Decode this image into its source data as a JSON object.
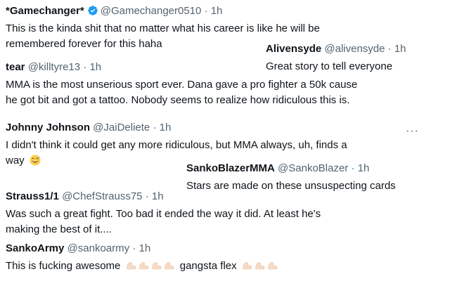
{
  "posts": [
    {
      "name": "*Gamechanger*",
      "handle": "@Gamechanger0510",
      "sep": "·",
      "time": "1h",
      "lines": [
        "This is the kinda shit that no matter what his career is like he will be",
        "remembered forever for this haha"
      ]
    },
    {
      "name": "Alivensyde",
      "handle": "@alivensyde",
      "sep": "·",
      "time": "1h",
      "lines": [
        "Great story to tell everyone"
      ]
    },
    {
      "name": "tear",
      "handle": "@killtyre13",
      "sep": "·",
      "time": "1h",
      "lines": [
        "MMA is the most unserious sport ever. Dana gave a pro fighter a 50k cause",
        "he got bit and got a tattoo. Nobody seems to realize how ridiculous this is."
      ]
    },
    {
      "name": "Johnny Johnson",
      "handle": "@JaiDeliete",
      "sep": "·",
      "time": "1h",
      "lines": [
        "I didn't think it could get any more ridiculous, but MMA always, uh, finds a",
        "way"
      ],
      "more": "···"
    },
    {
      "name": "SankoBlazerMMA",
      "handle": "@SankoBlazer",
      "sep": "·",
      "time": "1h",
      "lines": [
        "Stars are made on these unsuspecting cards"
      ]
    },
    {
      "name": "Strauss1/1",
      "handle": "@ChefStrauss75",
      "sep": "·",
      "time": "1h",
      "lines": [
        "Was such a great fight.  Too bad it ended the way it did.  At least he's",
        "making the best of it...."
      ]
    },
    {
      "name": "SankoArmy",
      "handle": "@sankoarmy",
      "sep": "·",
      "time": "1h",
      "text_a": "This is fucking awesome",
      "text_b": "gangsta flex"
    }
  ],
  "icons": {
    "verified": "verified-badge-icon",
    "sweat_emoji": "grinning-sweat-emoji",
    "flex_emoji": "flexed-biceps-emoji"
  },
  "colors": {
    "text": "#0f1419",
    "muted": "#536471",
    "verified": "#1d9bf0"
  }
}
